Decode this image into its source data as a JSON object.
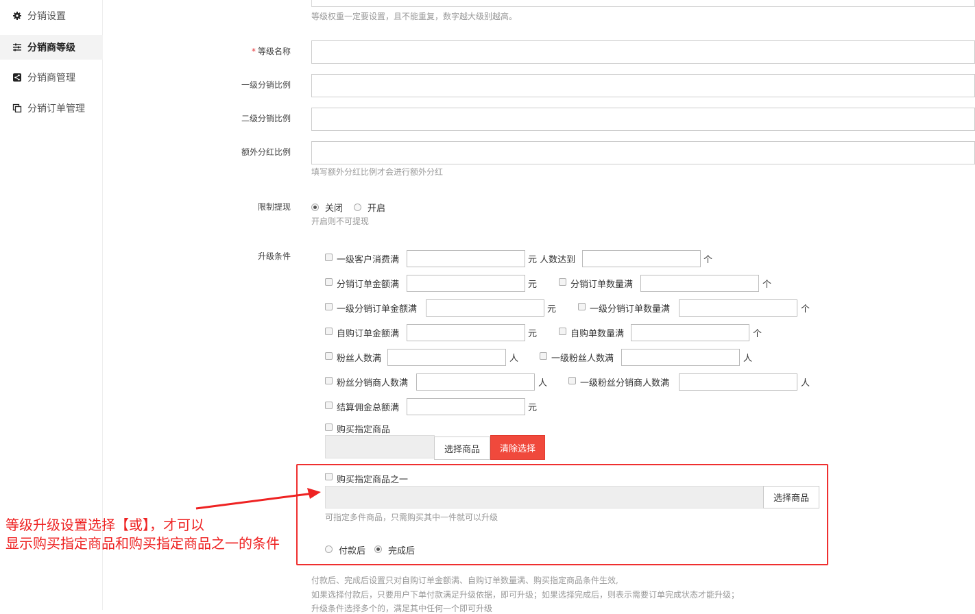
{
  "sidebar": {
    "items": [
      {
        "label": "分销设置",
        "icon": "gear-icon"
      },
      {
        "label": "分销商等级",
        "icon": "sliders-icon"
      },
      {
        "label": "分销商管理",
        "icon": "share-icon"
      },
      {
        "label": "分销订单管理",
        "icon": "copy-icon"
      }
    ]
  },
  "form": {
    "top_help": "等级权重一定要设置，且不能重复，数字越大级别越高。",
    "level_name": {
      "label": "等级名称",
      "required_mark": "*",
      "value": ""
    },
    "first_ratio": {
      "label": "一级分销比例",
      "value": ""
    },
    "second_ratio": {
      "label": "二级分销比例",
      "value": ""
    },
    "extra_ratio": {
      "label": "额外分红比例",
      "value": "",
      "help": "填写额外分红比例才会进行额外分红"
    },
    "limit_withdraw": {
      "label": "限制提现",
      "options": [
        "关闭",
        "开启"
      ],
      "selected": "关闭",
      "help": "开启则不可提现"
    },
    "upgrade": {
      "label": "升级条件",
      "conditions": {
        "c1": {
          "label": "一级客户消费满",
          "unit": "元 人数达到",
          "unit2": "个"
        },
        "c2": {
          "label": "分销订单金额满",
          "unit": "元"
        },
        "c3": {
          "label": "分销订单数量满",
          "unit": "个"
        },
        "c4": {
          "label": "一级分销订单金额满",
          "unit": "元"
        },
        "c5": {
          "label": "一级分销订单数量满",
          "unit": "个"
        },
        "c6": {
          "label": "自购订单金额满",
          "unit": "元"
        },
        "c7": {
          "label": "自购单数量满",
          "unit": "个"
        },
        "c8": {
          "label": "粉丝人数满",
          "unit": "人"
        },
        "c9": {
          "label": "一级粉丝人数满",
          "unit": "人"
        },
        "c10": {
          "label": "粉丝分销商人数满",
          "unit": "人"
        },
        "c11": {
          "label": "一级粉丝分销商人数满",
          "unit": "人"
        },
        "c12": {
          "label": "结算佣金总额满",
          "unit": "元"
        }
      },
      "buy_goods": {
        "label": "购买指定商品",
        "select_btn": "选择商品",
        "clear_btn": "清除选择"
      },
      "buy_one_of": {
        "label": "购买指定商品之一",
        "select_btn": "选择商品",
        "help": "可指定多件商品，只需购买其中一件就可以升级"
      },
      "timing": {
        "options": [
          "付款后",
          "完成后"
        ],
        "selected": "完成后"
      },
      "notes": [
        "付款后、完成后设置只对自购订单金额满、自购订单数量满、购买指定商品条件生效,",
        "如果选择付款后，只要用户下单付款满足升级依据，即可升级；如果选择完成后，则表示需要订单完成状态才能升级；",
        "升级条件选择多个的，满足其中任何一个即可升级"
      ]
    }
  },
  "annotation": {
    "line1": "等级升级设置选择【或】，才可以",
    "line2": "显示购买指定商品和购买指定商品之一的条件",
    "color": "#ee2222"
  }
}
